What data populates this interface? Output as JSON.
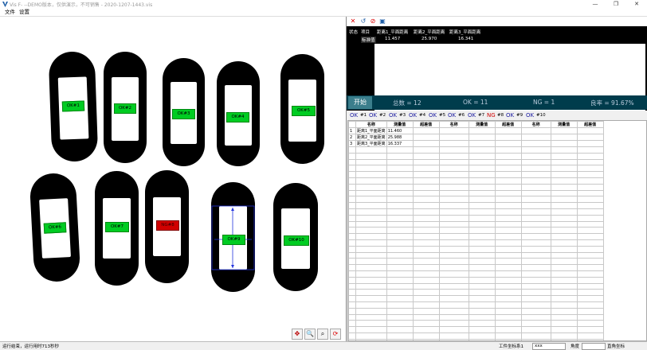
{
  "window": {
    "title": "Vis F- --DEMO版本，仅供演示，不可销售 - 2020-1207-1443.vis",
    "minimize": "—",
    "maximize": "❐",
    "close": "✕"
  },
  "menu": {
    "file": "文件",
    "settings": "设置"
  },
  "images": [
    {
      "label": "OK#1",
      "status": "ok"
    },
    {
      "label": "OK#2",
      "status": "ok"
    },
    {
      "label": "OK#3",
      "status": "ok"
    },
    {
      "label": "OK#4",
      "status": "ok"
    },
    {
      "label": "OK#5",
      "status": "ok"
    },
    {
      "label": "OK#6",
      "status": "ok"
    },
    {
      "label": "OK#7",
      "status": "ok"
    },
    {
      "label": "NG#8",
      "status": "ng"
    },
    {
      "label": "OK#9",
      "status": "ok"
    },
    {
      "label": "OK#10",
      "status": "ok"
    }
  ],
  "result_table": {
    "headers": [
      "状态",
      "项目",
      "距离1_平面距离",
      "距离2_平面距离",
      "距离3_平面距离"
    ],
    "row_label": "标准值",
    "values": [
      "11.457",
      "25.970",
      "16.341"
    ]
  },
  "stats": {
    "start_label": "开始",
    "total": "总数 = 12",
    "ok": "OK = 11",
    "ng": "NG = 1",
    "yield": "良率 = 91.67%"
  },
  "ok_flags": [
    {
      "text": "OK",
      "num": "#1",
      "status": "ok"
    },
    {
      "text": "OK",
      "num": "#2",
      "status": "ok"
    },
    {
      "text": "OK",
      "num": "#3",
      "status": "ok"
    },
    {
      "text": "OK",
      "num": "#4",
      "status": "ok"
    },
    {
      "text": "OK",
      "num": "#5",
      "status": "ok"
    },
    {
      "text": "OK",
      "num": "#6",
      "status": "ok"
    },
    {
      "text": "OK",
      "num": "#7",
      "status": "ok"
    },
    {
      "text": "NG",
      "num": "#8",
      "status": "ng"
    },
    {
      "text": "OK",
      "num": "#9",
      "status": "ok"
    },
    {
      "text": "OK",
      "num": "#10",
      "status": "ok"
    }
  ],
  "grid": {
    "headers": [
      "",
      "名称",
      "测量值",
      "超差值",
      "名称",
      "测量值",
      "超差值",
      "名称",
      "测量值",
      "超差值"
    ],
    "rows": [
      [
        "1",
        "距离1_平面距离",
        "11.460"
      ],
      [
        "2",
        "距离2_平面距离",
        "25.988"
      ],
      [
        "3",
        "距离3_平面距离",
        "16.337"
      ]
    ]
  },
  "status": {
    "message": "运行结束，运行用时713秒秒",
    "coord_label": "工件坐标系1",
    "coord_value": "xxx",
    "angle_label": "角度",
    "corner_label": "直角坐标"
  }
}
